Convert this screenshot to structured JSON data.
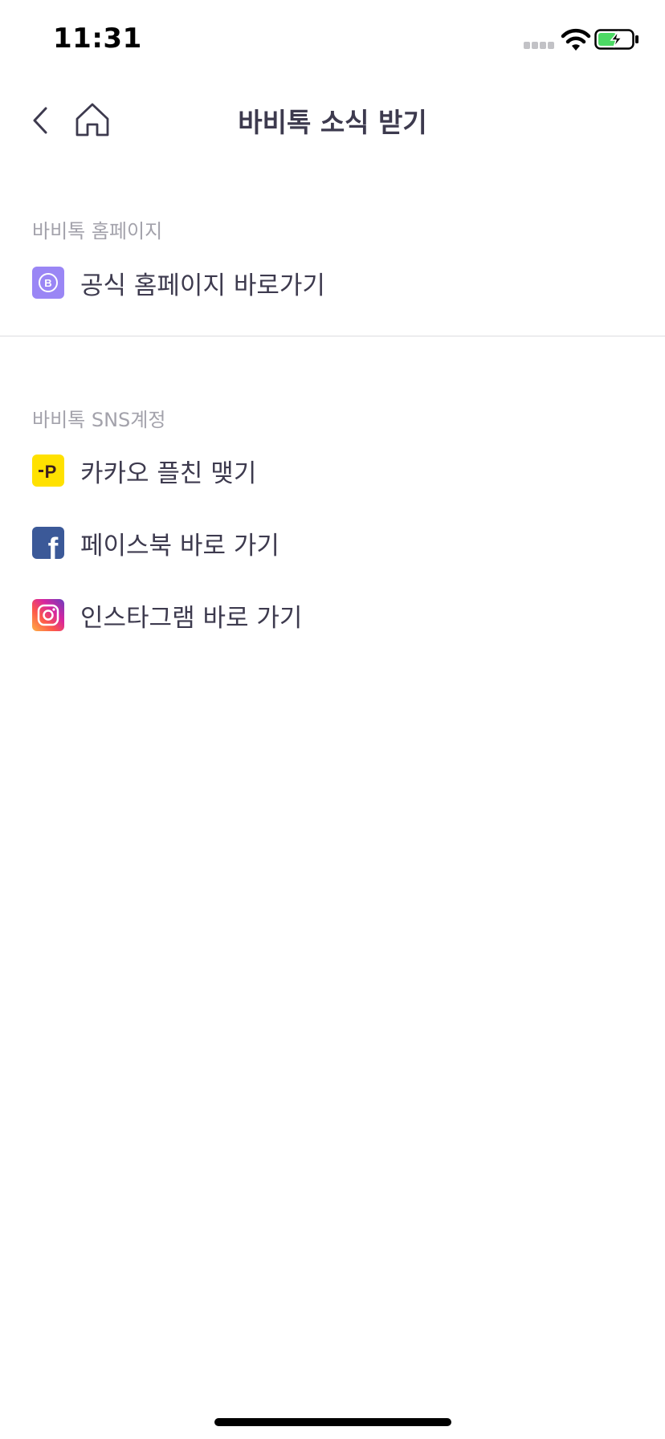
{
  "status_bar": {
    "time": "11:31"
  },
  "nav": {
    "title": "바비톡 소식 받기",
    "back_icon": "chevron-left-icon",
    "home_icon": "home-icon"
  },
  "sections": [
    {
      "header": "바비톡 홈페이지",
      "items": [
        {
          "label": "공식 홈페이지 바로가기",
          "icon": "babitalk-logo-icon",
          "icon_letter": "B",
          "color": "#9a86f5"
        }
      ]
    },
    {
      "header": "바비톡 SNS계정",
      "items": [
        {
          "label": "카카오 플친 맺기",
          "icon": "kakao-plus-friend-icon",
          "icon_letter": "P",
          "color": "#ffe100"
        },
        {
          "label": "페이스북 바로 가기",
          "icon": "facebook-icon",
          "icon_letter": "f",
          "color": "#3b5998"
        },
        {
          "label": "인스타그램 바로 가기",
          "icon": "instagram-icon",
          "color": "#d6249f"
        }
      ]
    }
  ]
}
